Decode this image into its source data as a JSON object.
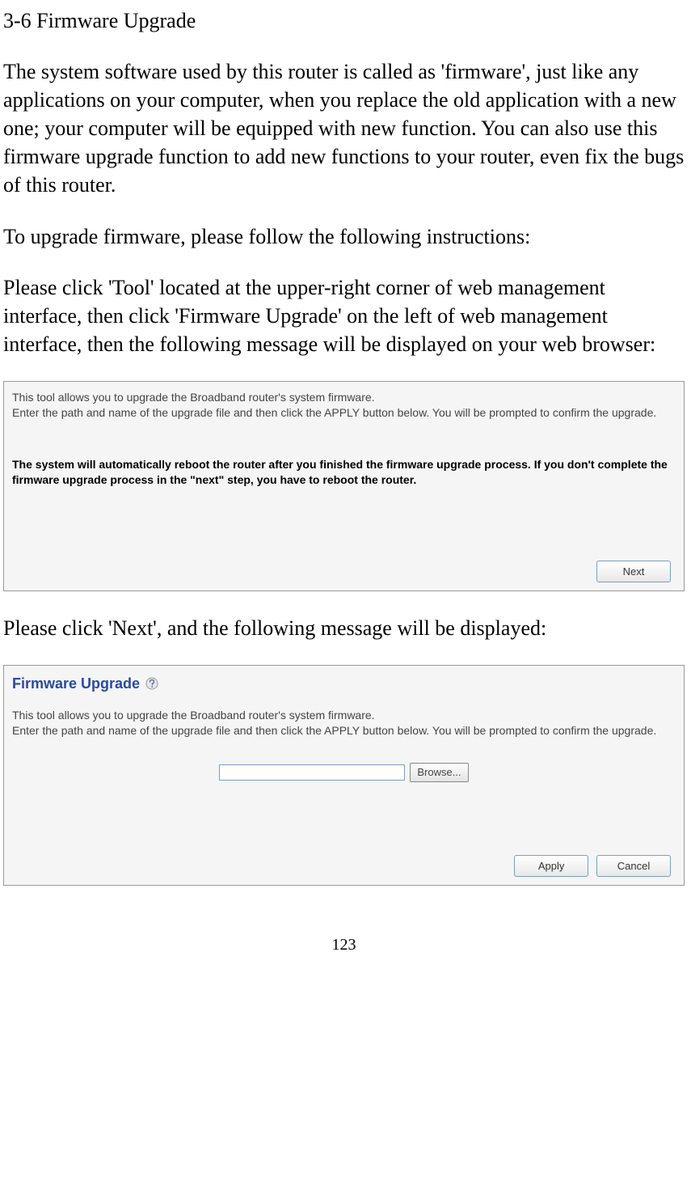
{
  "heading": "3-6 Firmware Upgrade",
  "para1": "The system software used by this router is called as 'firmware', just like any applications on your computer, when you replace the old application with a new one; your computer will be equipped with new function. You can also use this firmware upgrade function to add new functions to your router, even fix the bugs of this router.",
  "para2": "To upgrade firmware, please follow the following instructions:",
  "para3": "Please click 'Tool' located at the upper-right corner of web management interface, then click 'Firmware Upgrade' on the left of web management interface, then the following message will be displayed on your web browser:",
  "panel1": {
    "instruction": "This tool allows you to upgrade the Broadband router's system firmware.\nEnter the path and name of the upgrade file and then click the APPLY button below.  You will be prompted to confirm the upgrade.",
    "warning": "The system will automatically reboot the router after you finished the firmware upgrade process. If you don't complete the firmware upgrade process in the \"next\" step, you have to reboot the router.",
    "next_label": "Next"
  },
  "para4": "Please click 'Next', and the following message will be displayed:",
  "panel2": {
    "title": "Firmware Upgrade",
    "instruction": "This tool allows you to upgrade the Broadband router's system firmware.\nEnter the path and name of the upgrade file and then click the APPLY button below.  You will be prompted to confirm the upgrade.",
    "file_value": "",
    "browse_label": "Browse...",
    "apply_label": "Apply",
    "cancel_label": "Cancel"
  },
  "page_number": "123"
}
